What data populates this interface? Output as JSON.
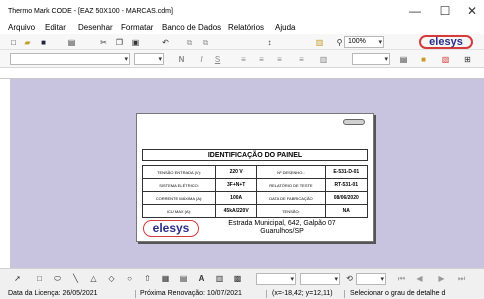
{
  "window": {
    "title": "Thermo Mark CODE - [EAZ 50X100 - MARCAS.cdm]",
    "minimize": "—",
    "maximize": "☐",
    "close": "✕"
  },
  "menu": [
    "Arquivo",
    "Editar",
    "Desenhar",
    "Formatar",
    "Banco de Dados",
    "Relatórios",
    "Ajuda"
  ],
  "toolbar": {
    "zoom": "100%",
    "brand": "elesys",
    "brand_color": "#d43b3b"
  },
  "label": {
    "header": "IDENTIFICAÇÃO DO PAINEL",
    "rows": [
      [
        "TENSÃO ENTRADA (V):",
        "220 V",
        "Nº DESENHO.:",
        "E-531-D-01"
      ],
      [
        "SISTEMA ELÉTRICO:",
        "3F+N+T",
        "RELATÓRIO DE TESTE",
        "RT-531-01"
      ],
      [
        "CORRENTE MÁXIMA (A):",
        "100A",
        "DATA DE FABRICAÇÃO",
        "08/06/2020"
      ],
      [
        "ICU MAX (A):",
        "45kA/220V",
        "TENSÃO:",
        "NA"
      ]
    ],
    "logo": "elesys",
    "address": "Estrada Municipal, 642, Galpão 07 Guarulhos/SP"
  },
  "status": {
    "license": "Data da Licença: 26/05/2021",
    "renewal": "Próxima Renovação: 10/07/2021",
    "coords": "(x=-18,42; y=12,11)",
    "hint": "Selecionar o grau de detalhe d"
  }
}
